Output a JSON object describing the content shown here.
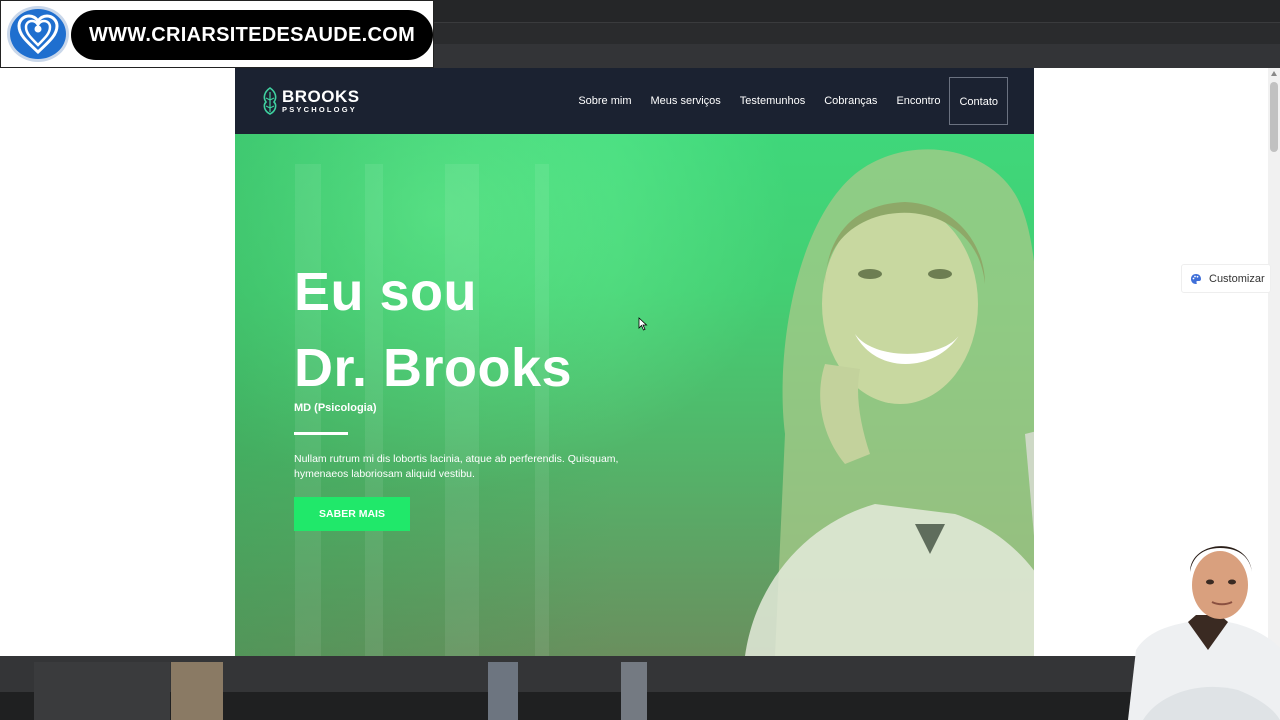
{
  "watermark": {
    "url_text": "WWW.CRIARSITEDESAUDE.COM",
    "logo_icon": "heart-location-logo-icon"
  },
  "site": {
    "brand": {
      "name": "BROOKS",
      "tagline": "PSYCHOLOGY"
    },
    "nav": [
      {
        "label": "Sobre mim"
      },
      {
        "label": "Meus serviços"
      },
      {
        "label": "Testemunhos"
      },
      {
        "label": "Cobranças"
      },
      {
        "label": "Encontro"
      },
      {
        "label": "Contato"
      }
    ],
    "hero": {
      "title_line1": "Eu sou",
      "title_line2": "Dr. Brooks",
      "subtitle": "MD (Psicologia)",
      "body": "Nullam rutrum mi dis lobortis lacinia, atque ab perferendis. Quisquam, hymenaeos laboriosam aliquid vestibu.",
      "button_label": "SABER MAIS"
    }
  },
  "customize": {
    "label": "Customizar",
    "icon": "palette-icon"
  },
  "colors": {
    "nav_bg": "#1b2231",
    "hero_green": "#43cf73",
    "button_green": "#20e86a",
    "watermark_pill": "#000000"
  }
}
